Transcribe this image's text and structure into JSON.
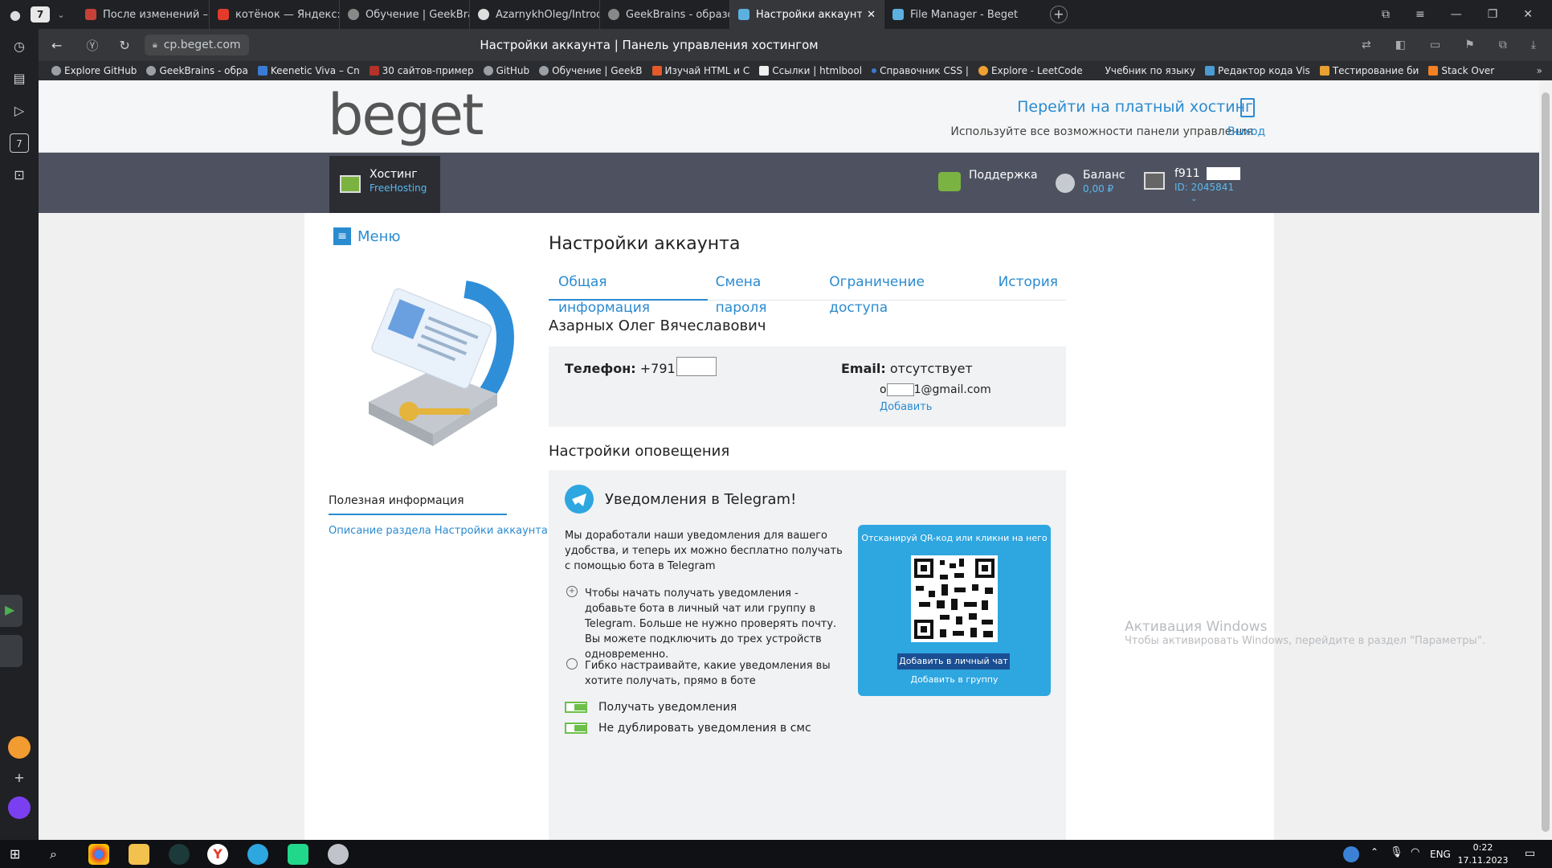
{
  "browser": {
    "tab_count": "7",
    "tabs": [
      {
        "title": "После изменений – Слова"
      },
      {
        "title": "котёнок — Яндекс: нашло"
      },
      {
        "title": "Обучение | GeekBrains - о"
      },
      {
        "title": "AzarnykhOleg/Introductio"
      },
      {
        "title": "GeekBrains - образовател"
      },
      {
        "title": "Настройки аккаунта | П"
      },
      {
        "title": "File Manager - Beget"
      }
    ],
    "url": "cp.beget.com",
    "page_title": "Настройки аккаунта | Панель управления хостингом",
    "bookmarks": [
      "Explore GitHub",
      "GeekBrains - обра",
      "Keenetic Viva – Cn",
      "30 сайтов-пример",
      "GitHub",
      "Обучение | GeekB",
      "Изучай HTML и C",
      "Ссылки | htmlbool",
      "Справочник CSS |",
      "Explore - LeetCode",
      "Учебник по языку",
      "Редактор кода Vis",
      "Тестирование би",
      "Stack Over"
    ],
    "left_badge": "7"
  },
  "header": {
    "logo": "beget",
    "promo_title": "Перейти на платный хостинг",
    "promo_sub": "Используйте все возможности панели управления",
    "logout": "Выход"
  },
  "topnav": {
    "hosting_title": "Хостинг",
    "hosting_plan": "FreeHosting",
    "support": "Поддержка",
    "balance_title": "Баланс",
    "balance_value": "0,00 ₽",
    "user_login": "f911",
    "user_id": "ID: 2045841"
  },
  "sidebar": {
    "menu": "Меню",
    "useful_title": "Полезная информация",
    "useful_link": "Описание раздела Настройки аккаунта"
  },
  "main": {
    "title": "Настройки аккаунта",
    "tabs": [
      "Общая информация",
      "Смена пароля",
      "Ограничение доступа",
      "История"
    ],
    "full_name": "Азарных Олег Вячеславович",
    "phone_label": "Телефон:",
    "phone_value": "+7911349",
    "email_label": "Email:",
    "email_value": "отсутствует",
    "email_prefix": "o",
    "email_suffix": "1@gmail.com",
    "add_link": "Добавить",
    "notif_title": "Настройки оповещения",
    "tg_title": "Уведомления в Telegram!",
    "tg_desc": "Мы доработали наши уведомления для вашего удобства, и теперь их можно бесплатно получать с помощью бота в Telegram",
    "tg_point1": "Чтобы начать получать уведомления - добавьте бота в личный чат или группу в Telegram. Больше не нужно проверять почту. Вы можете подключить до трех устройств одновременно.",
    "tg_point2": "Гибко настраивайте, какие уведомления вы хотите получать, прямо в боте",
    "qr_caption": "Отсканируй QR-код или кликни на него",
    "btn_private": "Добавить в личный чат",
    "btn_group": "Добавить в группу",
    "check1": "Получать уведомления",
    "check2": "Не дублировать уведомления в смс"
  },
  "watermark": {
    "title": "Активация Windows",
    "sub": "Чтобы активировать Windows, перейдите в раздел \"Параметры\"."
  },
  "taskbar": {
    "lang": "ENG",
    "time": "0:22",
    "date": "17.11.2023"
  },
  "colors": {
    "accent": "#2b8bd0",
    "darkbar": "#4e5260",
    "telegram": "#2ea6e0",
    "check": "#6cc04a"
  }
}
